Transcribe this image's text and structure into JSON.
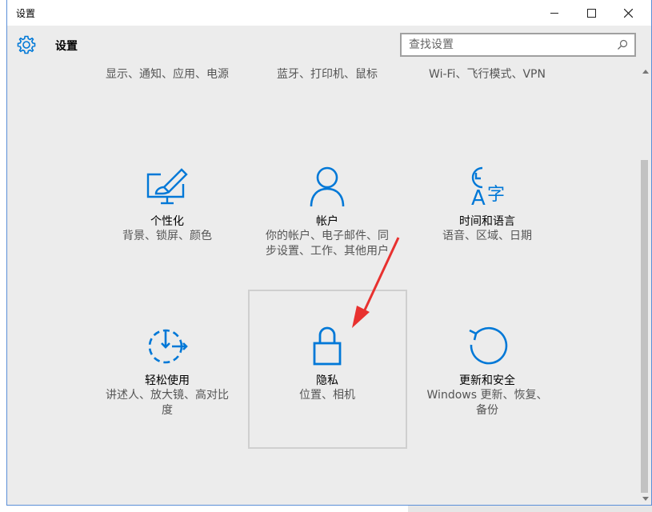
{
  "window": {
    "title": "设置",
    "app_title": "设置",
    "accent": "#0078d7"
  },
  "search": {
    "placeholder": "查找设置"
  },
  "top_row": [
    {
      "desc": "显示、通知、应用、电源"
    },
    {
      "desc": "蓝牙、打印机、鼠标"
    },
    {
      "desc": "Wi-Fi、飞行模式、VPN"
    }
  ],
  "tiles": [
    {
      "icon": "personalization-icon",
      "name": "个性化",
      "desc": "背景、锁屏、颜色"
    },
    {
      "icon": "account-icon",
      "name": "帐户",
      "desc": "你的帐户、电子邮件、同步设置、工作、其他用户"
    },
    {
      "icon": "time-language-icon",
      "name": "时间和语言",
      "desc": "语音、区域、日期"
    },
    {
      "icon": "ease-of-access-icon",
      "name": "轻松使用",
      "desc": "讲述人、放大镜、高对比度"
    },
    {
      "icon": "lock-icon",
      "name": "隐私",
      "desc": "位置、相机"
    },
    {
      "icon": "update-icon",
      "name": "更新和安全",
      "desc": "Windows 更新、恢复、备份"
    }
  ],
  "annotation": {
    "color": "#e8312f"
  }
}
